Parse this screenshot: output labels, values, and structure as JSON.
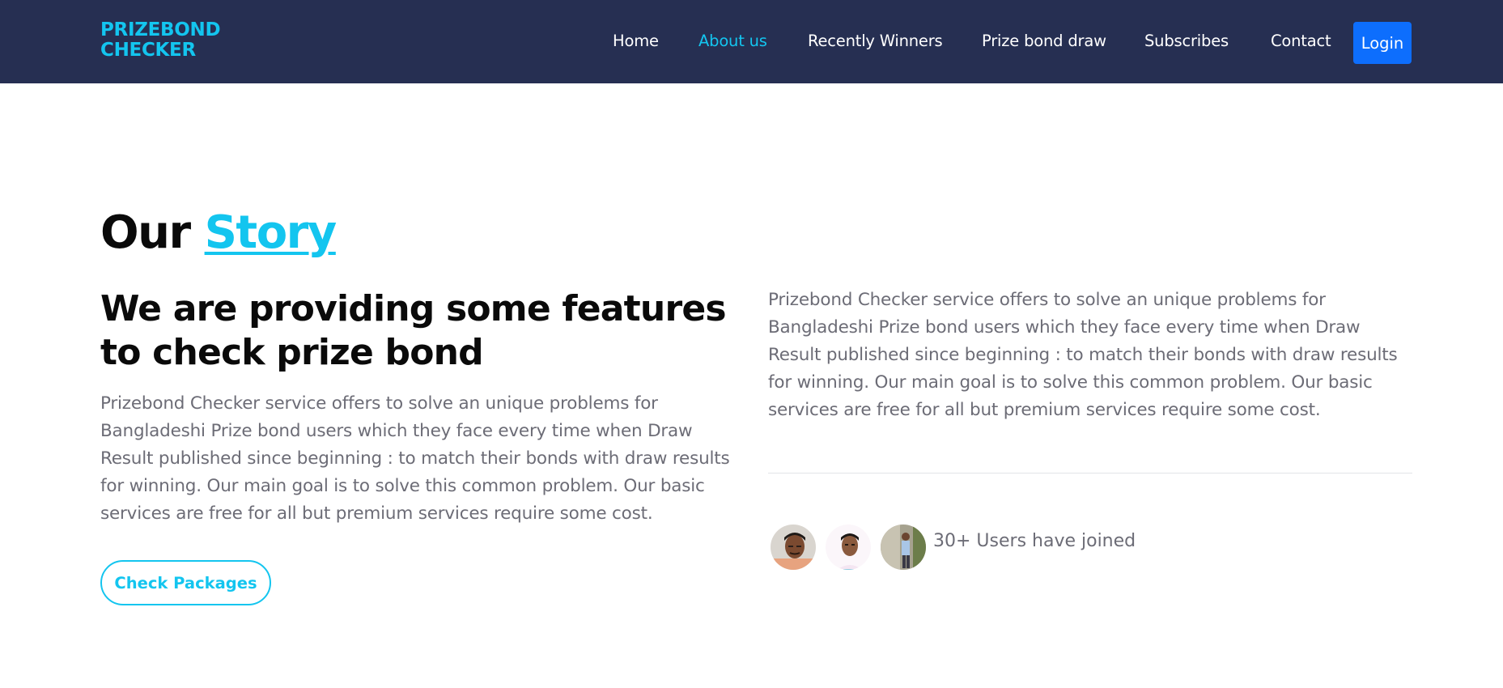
{
  "header": {
    "logo_line1": "PRIZEBOND",
    "logo_line2": "CHECKER",
    "nav": [
      {
        "label": "Home"
      },
      {
        "label": "About us"
      },
      {
        "label": "Recently Winners"
      },
      {
        "label": "Prize bond draw"
      },
      {
        "label": "Subscribes"
      },
      {
        "label": "Contact"
      }
    ],
    "login_label": "Login"
  },
  "story": {
    "title_plain": "Our ",
    "title_accent": "Story",
    "headline": "We are providing some features to check prize bond",
    "paragraph_left": "Prizebond Checker service offers to solve an unique problems for Bangladeshi Prize bond users which they face every time when Draw Result published since beginning : to match their bonds with draw results for winning. Our main goal is to solve this common problem. Our basic services are free for all but premium services require some cost.",
    "paragraph_right": "Prizebond Checker service offers to solve an unique problems for Bangladeshi Prize bond users which they face every time when Draw Result published since beginning : to match their bonds with draw results for winning. Our main goal is to solve this common problem. Our basic services are free for all but premium services require some cost.",
    "button_label": "Check Packages",
    "users_joined": "30+ Users have joined"
  },
  "colors": {
    "navbar_bg": "#262f52",
    "accent": "#13c5ef",
    "login_bg": "#0d6efd",
    "body_text": "#6c6c76"
  }
}
